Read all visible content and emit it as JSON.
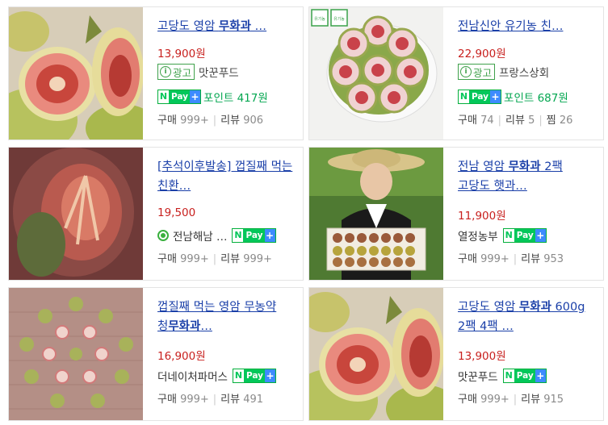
{
  "colors": {
    "title": "#1a3fa8",
    "price": "#c8201e",
    "npay": "#03c75a",
    "point": "#03a650",
    "ad": "#3fa14b"
  },
  "products": [
    {
      "title_pre": "고당도 영암 ",
      "title_hl": "무화과",
      "title_post": " …",
      "price": "13,900원",
      "ad": "광고",
      "seller": "맛꾼푸드",
      "npay": "Pay",
      "point": "포인트 417원",
      "buy_label": "구매",
      "buy_count": "999+",
      "review_label": "리뷰",
      "review_count": "906"
    },
    {
      "title_pre": "전남신안 유기농 친…",
      "title_hl": "",
      "title_post": "",
      "price": "22,900원",
      "ad": "광고",
      "seller": "프랑스상회",
      "npay": "Pay",
      "point": "포인트 687원",
      "buy_label": "구매",
      "buy_count": "74",
      "review_label": "리뷰",
      "review_count": "5",
      "fav_label": "찜",
      "fav_count": "26",
      "cert1": "유기농",
      "cert2": "유기농"
    },
    {
      "title_pre": "[추석이후발송] 껍질째 먹는 친환…",
      "title_hl": "",
      "title_post": "",
      "price": "19,500",
      "seller": "전남해남 …",
      "npay": "Pay",
      "buy_label": "구매",
      "buy_count": "999+",
      "review_label": "리뷰",
      "review_count": "999+"
    },
    {
      "title_pre": "전남 영암 ",
      "title_hl": "무화과",
      "title_post": " 2팩 고당도 햇과…",
      "price": "11,900원",
      "seller": "열정농부",
      "npay": "Pay",
      "buy_label": "구매",
      "buy_count": "999+",
      "review_label": "리뷰",
      "review_count": "953"
    },
    {
      "title_pre": "껍질째 먹는 영암 무농약 청",
      "title_hl": "무화과",
      "title_post": "…",
      "price": "16,900원",
      "seller": "더네이처파머스",
      "npay": "Pay",
      "buy_label": "구매",
      "buy_count": "999+",
      "review_label": "리뷰",
      "review_count": "491"
    },
    {
      "title_pre": "고당도 영암 ",
      "title_hl": "무화과",
      "title_post": " 600g 2팩 4팩 …",
      "price": "13,900원",
      "seller": "맛꾼푸드",
      "npay": "Pay",
      "buy_label": "구매",
      "buy_count": "999+",
      "review_label": "리뷰",
      "review_count": "915"
    }
  ]
}
